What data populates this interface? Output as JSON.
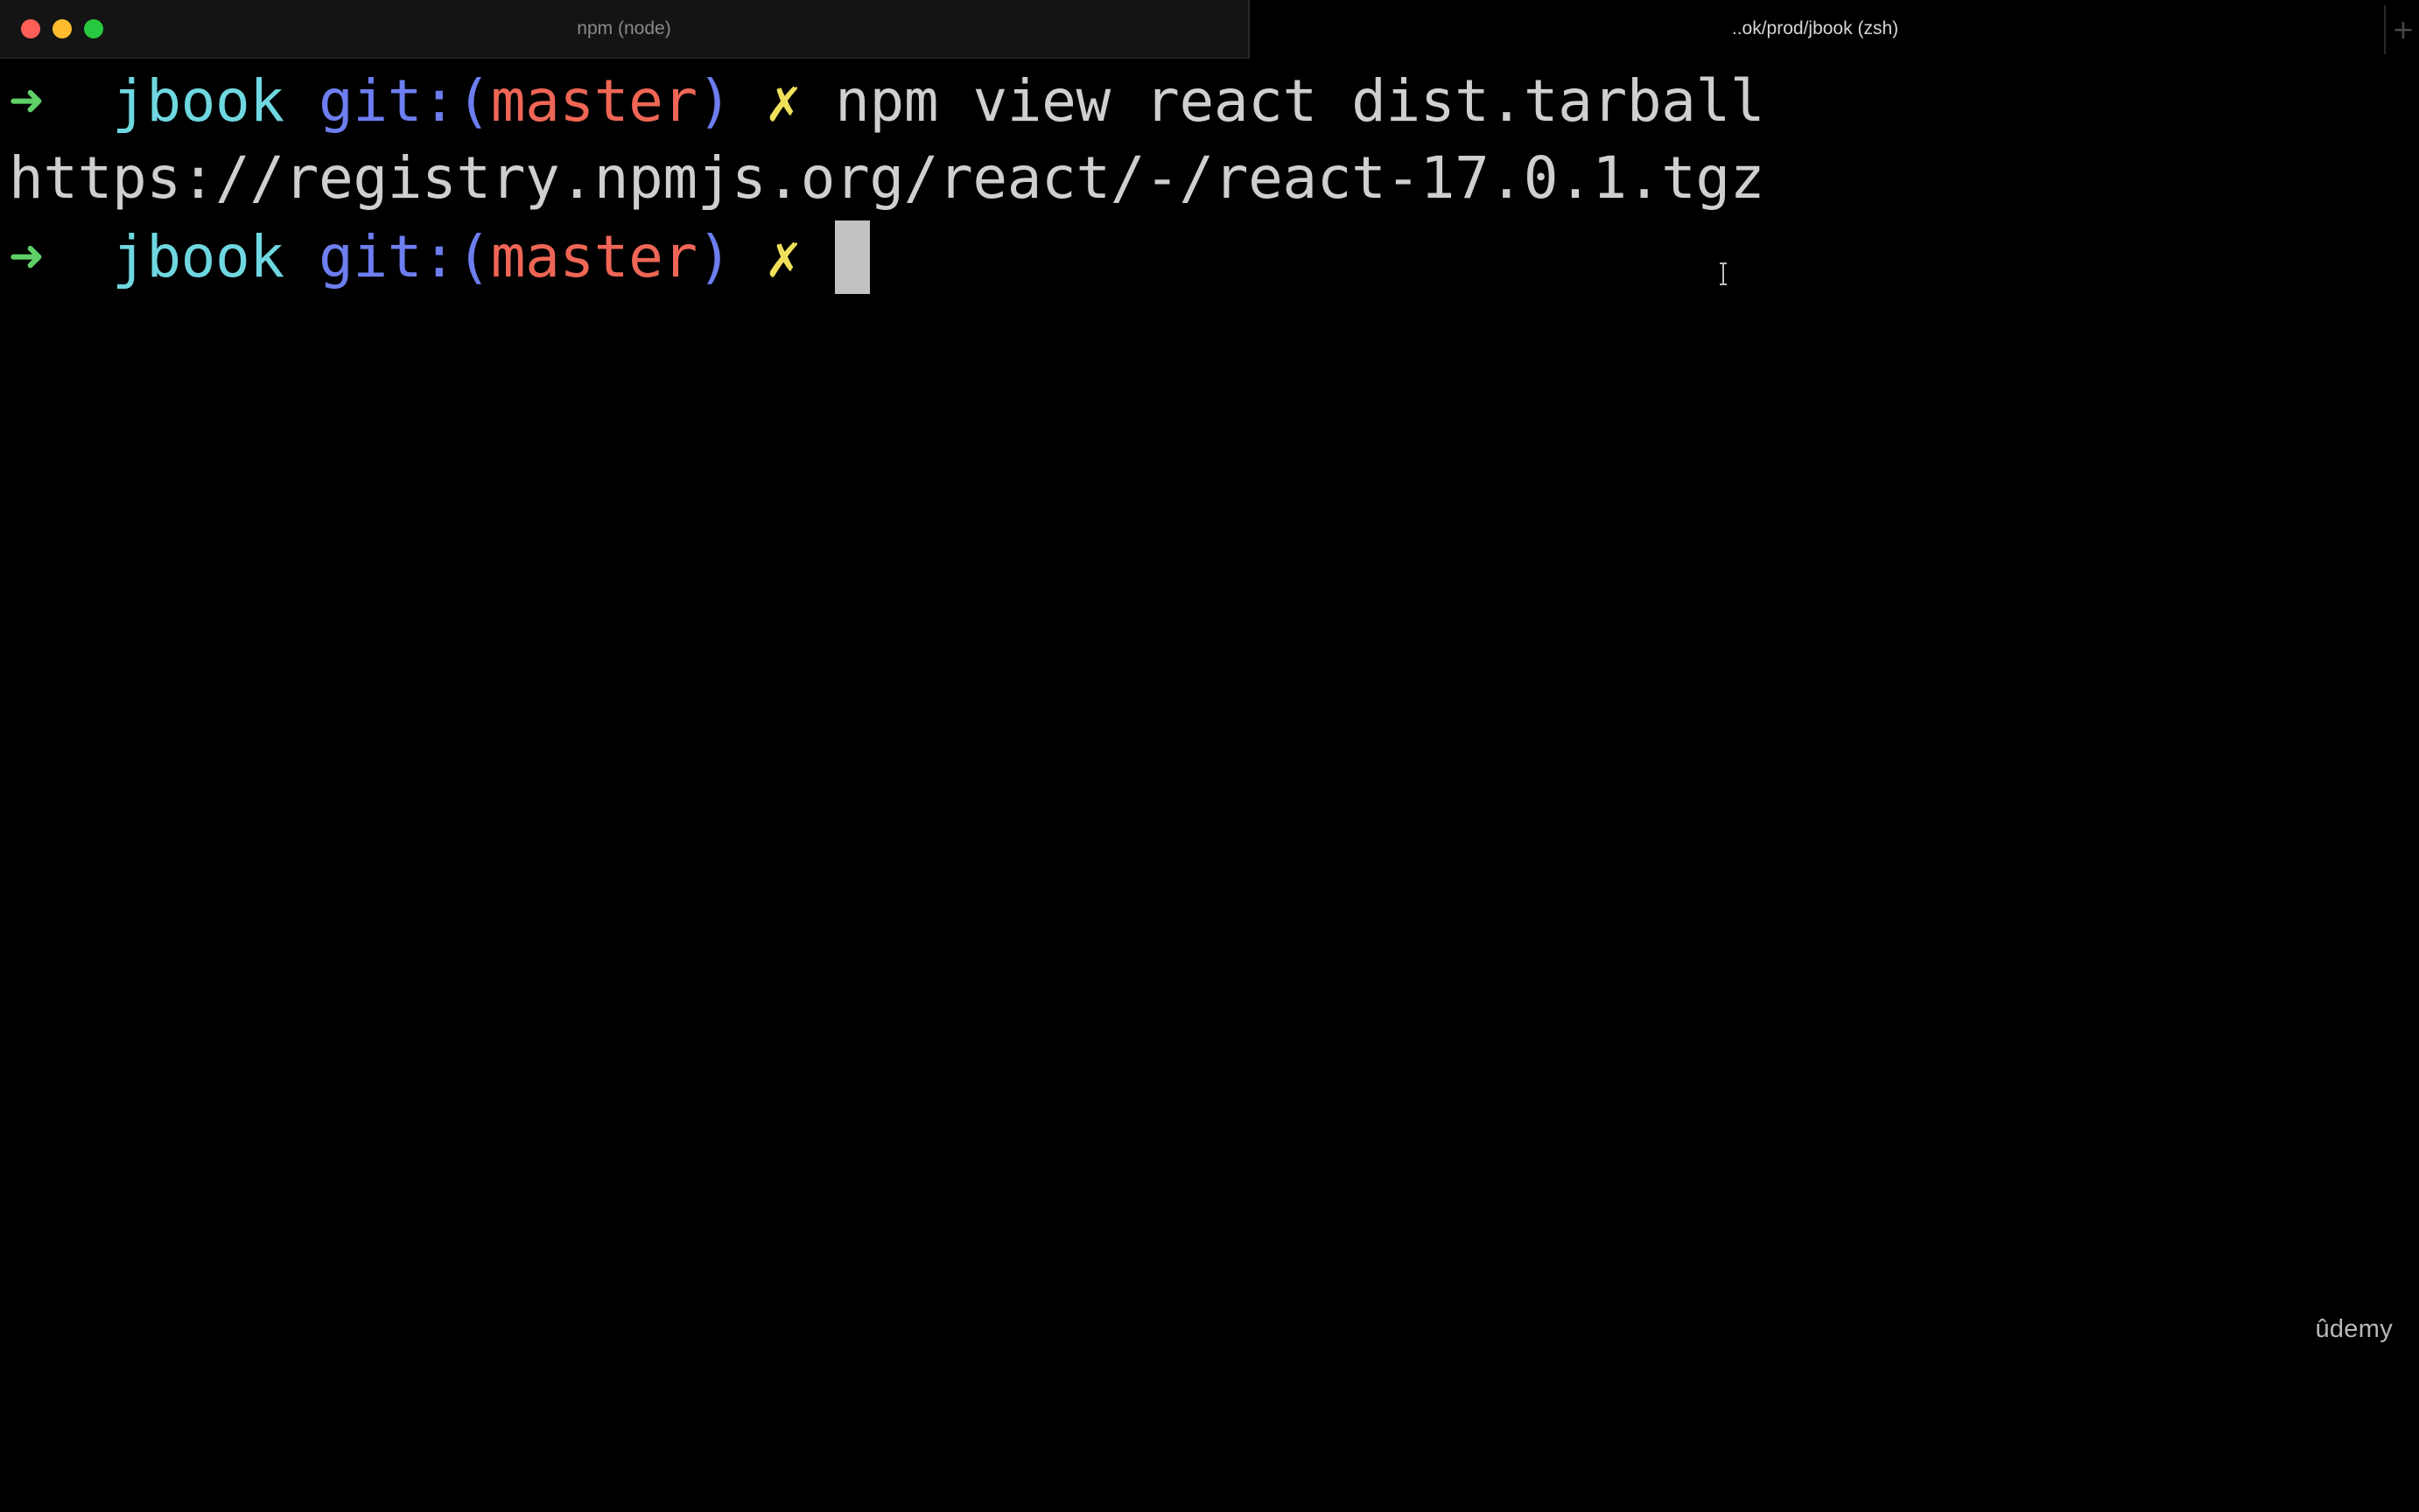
{
  "window": {
    "tabs": [
      {
        "label": "npm (node)"
      },
      {
        "label": "..ok/prod/jbook (zsh)"
      }
    ],
    "new_tab_icon": "plus-icon"
  },
  "terminal": {
    "lines": [
      {
        "prompt": {
          "arrow": "➜",
          "dir": "jbook",
          "git_prefix": "git:(",
          "branch": "master",
          "git_suffix": ")",
          "dirty": "✗"
        },
        "command": "npm view react dist.tarball"
      },
      {
        "output": "https://registry.npmjs.org/react/-/react-17.0.1.tgz"
      },
      {
        "prompt": {
          "arrow": "➜",
          "dir": "jbook",
          "git_prefix": "git:(",
          "branch": "master",
          "git_suffix": ")",
          "dirty": "✗"
        },
        "command": ""
      }
    ]
  },
  "watermark": "ûdemy",
  "colors": {
    "background": "#000000",
    "arrow": "#5fd068",
    "dir": "#6fd7e0",
    "git": "#6d7ef0",
    "branch": "#ef6656",
    "dirty": "#f0e05a",
    "text": "#cfcfcf",
    "cursor": "#c2c2c2"
  }
}
